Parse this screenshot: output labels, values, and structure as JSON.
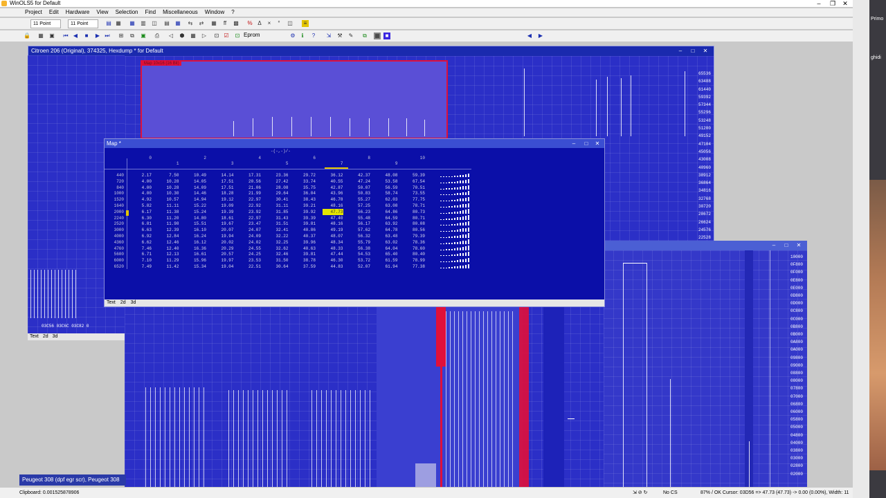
{
  "app": {
    "title": "WinOLS5 for Default"
  },
  "menu": [
    "Project",
    "Edit",
    "Hardware",
    "View",
    "Selection",
    "Find",
    "Miscellaneous",
    "Window",
    "?"
  ],
  "toolbar": {
    "font1": "11 Point",
    "font2": "11 Point",
    "eprom_label": "Eprom"
  },
  "main_window": {
    "title": "Citroen 206 (Original), 374325, Hexdump * for Default",
    "selected_map_label": "Map 10x16 (16 Bit)",
    "hex_labels": [
      "65536",
      "63488",
      "61440",
      "59392",
      "57344",
      "55296",
      "53248",
      "51200",
      "49152",
      "47104",
      "45056",
      "43008",
      "40960",
      "38912",
      "36864",
      "34816",
      "32768",
      "30720",
      "28672",
      "26624",
      "24576",
      "22528"
    ],
    "bottom_tabs": [
      "Text",
      "2d",
      "3d"
    ],
    "small_window_addresses": [
      "03C56",
      "03C6C",
      "03C82",
      "0"
    ]
  },
  "map_window": {
    "title": "Map *",
    "axis_label": "-(-,-)/-",
    "columns": [
      "0",
      "1",
      "2",
      "3",
      "4",
      "5",
      "6",
      "7",
      "8",
      "9",
      "10"
    ],
    "rows": [
      {
        "label": "440",
        "values": [
          "2.17",
          "7.50",
          "10.49",
          "14.14",
          "17.31",
          "23.36",
          "29.72",
          "36.12",
          "42.37",
          "48.08",
          "59.39"
        ]
      },
      {
        "label": "720",
        "values": [
          "4.00",
          "10.28",
          "14.05",
          "17.51",
          "20.56",
          "27.42",
          "33.74",
          "40.55",
          "47.24",
          "53.58",
          "67.54"
        ]
      },
      {
        "label": "840",
        "values": [
          "4.00",
          "10.28",
          "14.09",
          "17.51",
          "21.06",
          "28.08",
          "35.75",
          "42.87",
          "50.07",
          "56.59",
          "70.51"
        ]
      },
      {
        "label": "1000",
        "values": [
          "4.00",
          "10.30",
          "14.46",
          "18.28",
          "21.99",
          "29.64",
          "36.04",
          "43.96",
          "50.83",
          "58.74",
          "73.55"
        ]
      },
      {
        "label": "1520",
        "values": [
          "4.92",
          "10.57",
          "14.94",
          "19.12",
          "22.97",
          "30.41",
          "38.43",
          "46.78",
          "55.27",
          "62.03",
          "77.75"
        ]
      },
      {
        "label": "1640",
        "values": [
          "5.82",
          "11.11",
          "15.22",
          "19.09",
          "22.92",
          "31.11",
          "39.21",
          "48.16",
          "57.25",
          "63.08",
          "78.71"
        ]
      },
      {
        "label": "2000",
        "values": [
          "6.17",
          "11.38",
          "15.24",
          "19.39",
          "23.92",
          "31.85",
          "39.92",
          "47.73",
          "56.23",
          "64.86",
          "80.73"
        ]
      },
      {
        "label": "2240",
        "values": [
          "6.30",
          "11.20",
          "14.80",
          "18.61",
          "22.97",
          "31.43",
          "39.39",
          "47.40",
          "55.48",
          "64.59",
          "80.71"
        ]
      },
      {
        "label": "2520",
        "values": [
          "6.81",
          "11.98",
          "15.51",
          "19.67",
          "23.47",
          "31.51",
          "39.81",
          "48.16",
          "56.17",
          "63.92",
          "80.08"
        ]
      },
      {
        "label": "3000",
        "values": [
          "6.63",
          "12.39",
          "16.10",
          "20.07",
          "24.07",
          "32.41",
          "40.86",
          "49.19",
          "57.62",
          "64.78",
          "80.56"
        ]
      },
      {
        "label": "4000",
        "values": [
          "6.92",
          "12.84",
          "16.24",
          "19.94",
          "24.09",
          "32.22",
          "40.37",
          "48.07",
          "56.32",
          "63.48",
          "79.39"
        ]
      },
      {
        "label": "4360",
        "values": [
          "6.62",
          "12.46",
          "16.12",
          "20.02",
          "24.02",
          "32.25",
          "39.96",
          "48.34",
          "55.79",
          "63.02",
          "78.36"
        ]
      },
      {
        "label": "4760",
        "values": [
          "7.46",
          "12.40",
          "16.36",
          "20.29",
          "24.55",
          "32.62",
          "40.63",
          "48.33",
          "56.38",
          "64.04",
          "78.60"
        ]
      },
      {
        "label": "5600",
        "values": [
          "6.71",
          "12.13",
          "16.61",
          "20.57",
          "24.25",
          "32.46",
          "39.81",
          "47.44",
          "54.53",
          "65.40",
          "80.40"
        ]
      },
      {
        "label": "6000",
        "values": [
          "7.10",
          "11.29",
          "15.96",
          "19.97",
          "23.53",
          "31.50",
          "38.78",
          "46.30",
          "53.72",
          "61.59",
          "78.99"
        ]
      },
      {
        "label": "6520",
        "values": [
          "7.49",
          "11.42",
          "15.34",
          "19.04",
          "22.51",
          "30.64",
          "37.59",
          "44.83",
          "52.07",
          "61.94",
          "77.38"
        ]
      }
    ],
    "selected_value": "47.73",
    "tabs": [
      "Text",
      "2d",
      "3d"
    ]
  },
  "second_window": {
    "hex_labels": [
      "10000",
      "0F800",
      "0F000",
      "0E800",
      "0E000",
      "0D800",
      "0D000",
      "0C800",
      "0C000",
      "0B800",
      "0B000",
      "0A800",
      "0A000",
      "09800",
      "09000",
      "08800",
      "08000",
      "07800",
      "07000",
      "06800",
      "06000",
      "05800",
      "05000",
      "04800",
      "04000",
      "03800",
      "03000",
      "02800",
      "02000"
    ]
  },
  "tabs": {
    "project_tabs": [
      "Peugeot 308 (dpf egr scr)",
      "Peugeot 308"
    ]
  },
  "status": {
    "clipboard": "Clipboard: 0.001525878906",
    "checksum": "No CS",
    "cursor_info": "87% / OK  Cursor: 03D56 => 47.73 (47.73) -> 0.00 (0.00%), Width: 11"
  },
  "side": {
    "label1": "Primo",
    "label2": "ghidi"
  }
}
